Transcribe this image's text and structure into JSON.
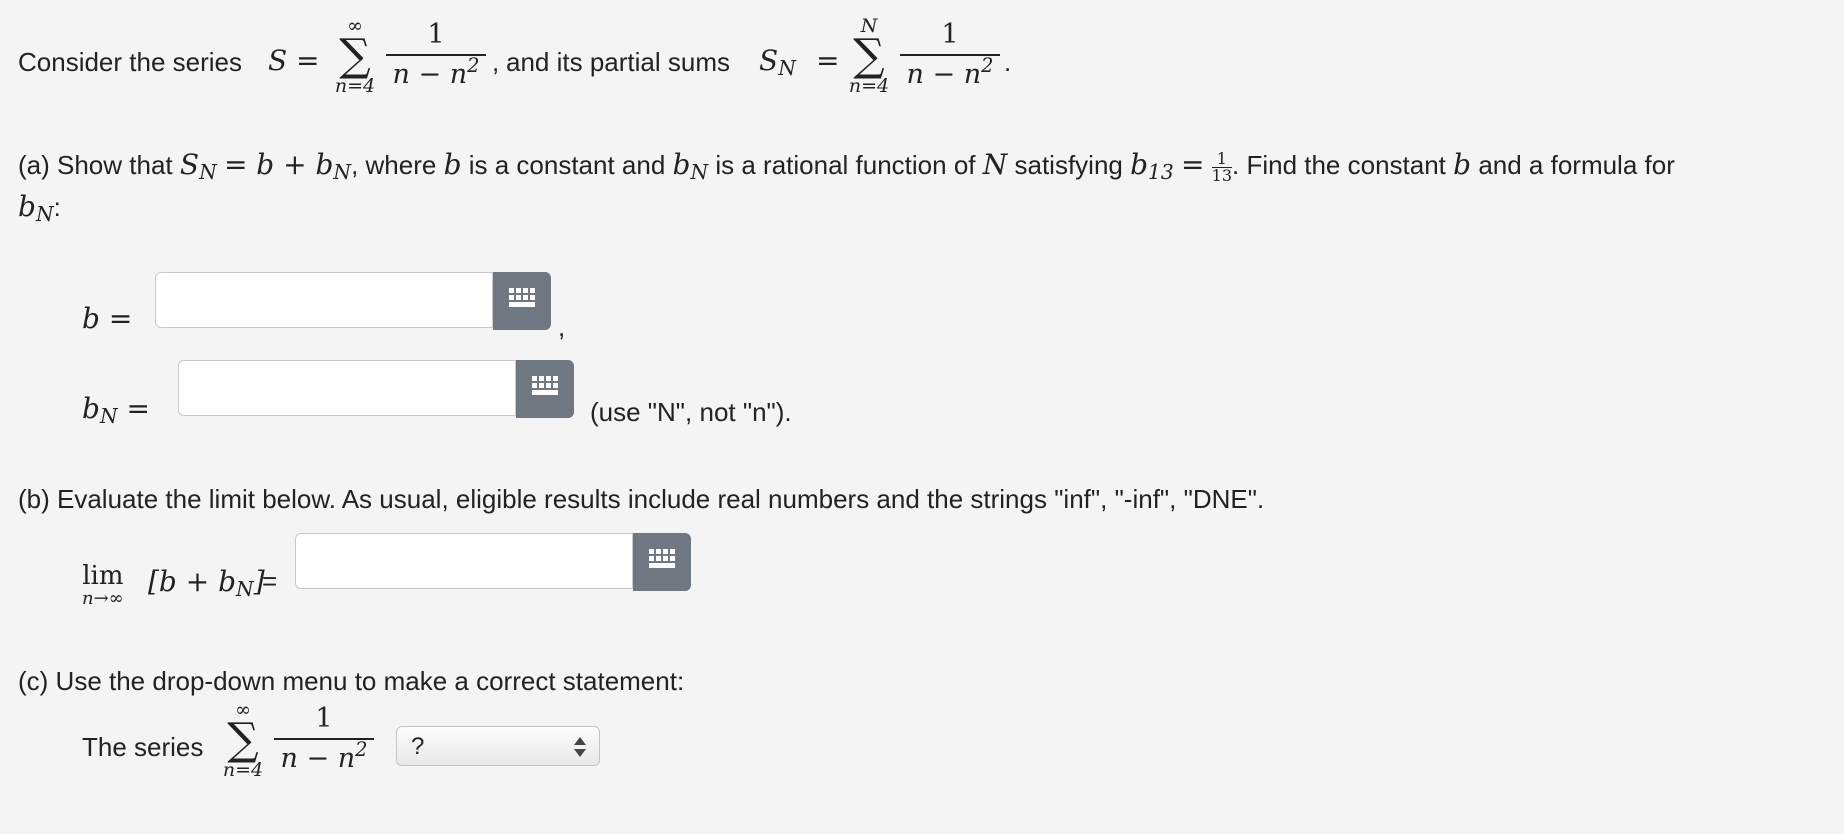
{
  "intro": {
    "prefix": "Consider the series",
    "mid": "and its partial sums",
    "S": "S",
    "eq": "=",
    "SN_base": "S",
    "SN_sub": "N",
    "sum1": {
      "top": "∞",
      "sigma": "∑",
      "bottom": "n=4"
    },
    "sum2": {
      "top": "N",
      "sigma": "∑",
      "bottom": "n=4"
    },
    "frac": {
      "num": "1",
      "den": "n − n"
    },
    "den_exp": "2",
    "comma": ",",
    "period": "."
  },
  "part_a": {
    "text1": "(a) Show that",
    "math1": "S",
    "math1_sub": "N",
    "math2": "= b + b",
    "math2_sub": "N",
    "text2": ", where",
    "b1": "b",
    "text3": "is a constant and",
    "b2": "b",
    "b2_sub": "N",
    "text4": "is a rational function of",
    "N": "N",
    "text5": "satisfying",
    "b3": "b",
    "b3_sub": "13",
    "eq": "=",
    "frac_num": "1",
    "frac_den": "13",
    "text6": ". Find the constant",
    "b4": "b",
    "text7": "and a formula for",
    "line2_b": "b",
    "line2_sub": "N",
    "line2_colon": ":"
  },
  "field_b": {
    "label": "b =",
    "value": "",
    "placeholder": "",
    "after": ","
  },
  "field_bN": {
    "label_base": "b",
    "label_sub": "N",
    "label_eq": "=",
    "value": "",
    "placeholder": "",
    "hint": "(use \"N\", not \"n\")."
  },
  "part_b": {
    "text": "(b) Evaluate the limit below. As usual, eligible results include real numbers and the strings \"inf\", \"-inf\", \"DNE\".",
    "lim": "lim",
    "lim_sub": "n→∞",
    "expr": "[b + b",
    "expr_sub": "N",
    "expr_close": "]",
    "eq": "=",
    "value": "",
    "placeholder": ""
  },
  "part_c": {
    "text": "(c) Use the drop-down menu to make a correct statement:",
    "series_label": "The series",
    "sum": {
      "top": "∞",
      "sigma": "∑",
      "bottom": "n=4"
    },
    "frac": {
      "num": "1",
      "den": "n − n"
    },
    "den_exp": "2",
    "select_value": "?"
  },
  "colors": {
    "background": "#f4f4f4",
    "keyboard_button": "#6f7780"
  },
  "icons": {
    "keyboard": "keyboard-icon",
    "select_arrows": "updown-arrows-icon"
  }
}
